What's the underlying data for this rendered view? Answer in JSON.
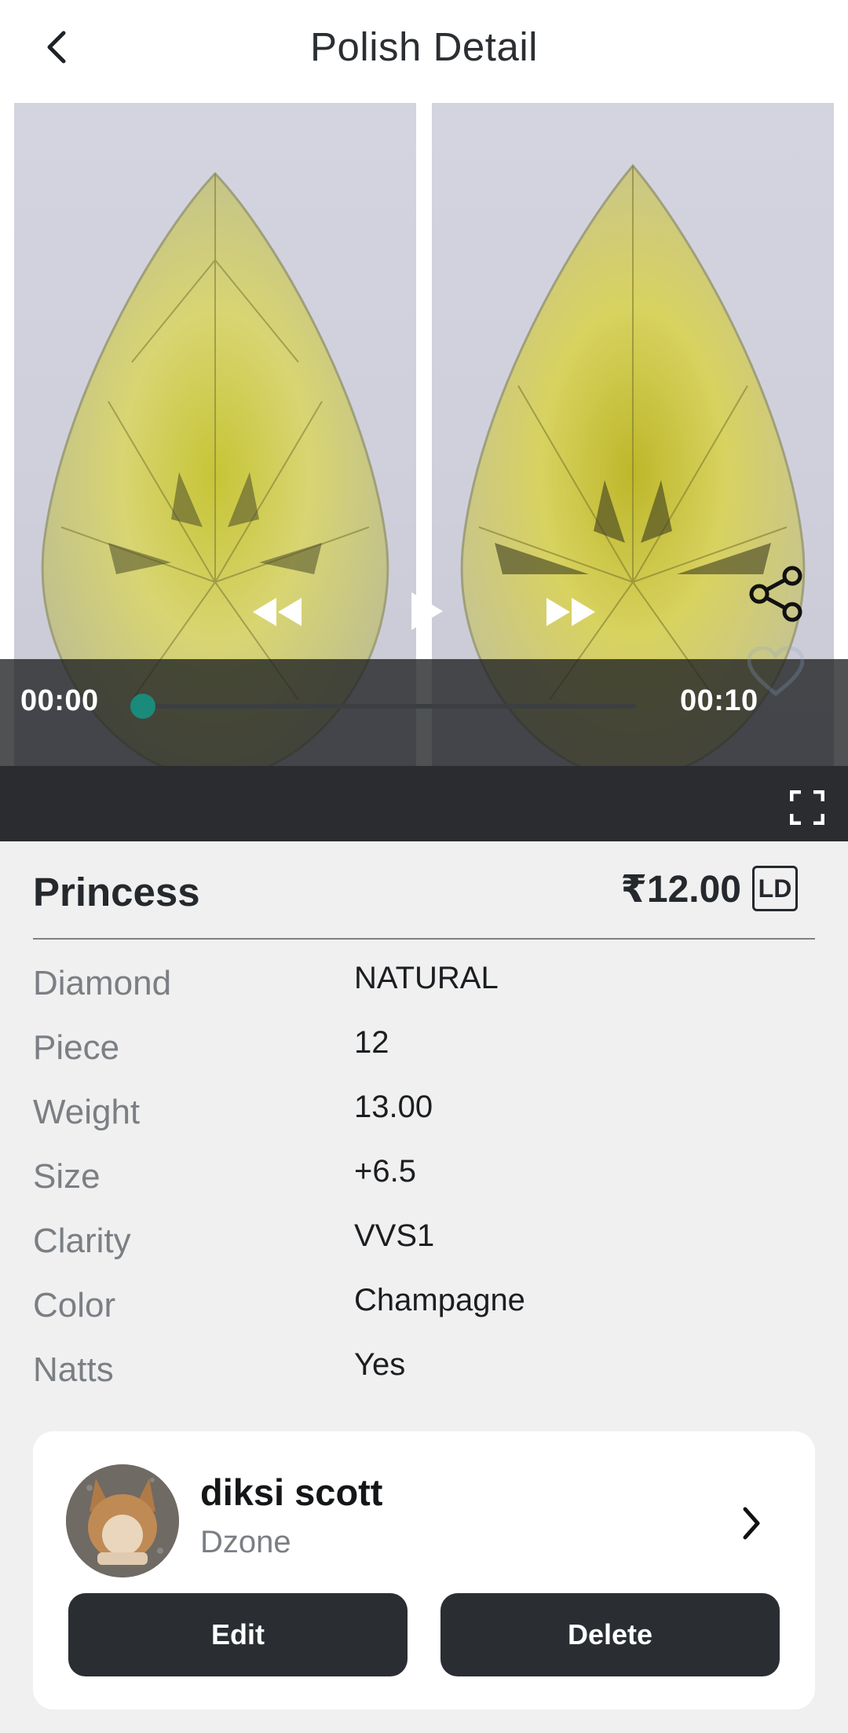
{
  "header": {
    "title": "Polish Detail",
    "back_icon": "chevron-left-icon"
  },
  "player": {
    "current_time": "00:00",
    "duration": "00:10",
    "progress": 0,
    "icons": [
      "rewind-icon",
      "play-icon",
      "fast-forward-icon",
      "share-icon",
      "heart-icon",
      "fullscreen-icon"
    ],
    "accent": "#1a8a7a"
  },
  "item": {
    "name": "Princess",
    "price": "₹12.00",
    "badge": "LD"
  },
  "specs": [
    {
      "label": "Diamond",
      "value": "NATURAL"
    },
    {
      "label": "Piece",
      "value": "12"
    },
    {
      "label": "Weight",
      "value": "13.00"
    },
    {
      "label": "Size",
      "value": "+6.5"
    },
    {
      "label": "Clarity",
      "value": "VVS1"
    },
    {
      "label": "Color",
      "value": "Champagne"
    },
    {
      "label": "Natts",
      "value": "Yes"
    }
  ],
  "seller": {
    "name": "diksi scott",
    "company": "Dzone",
    "edit_label": "Edit",
    "delete_label": "Delete"
  }
}
